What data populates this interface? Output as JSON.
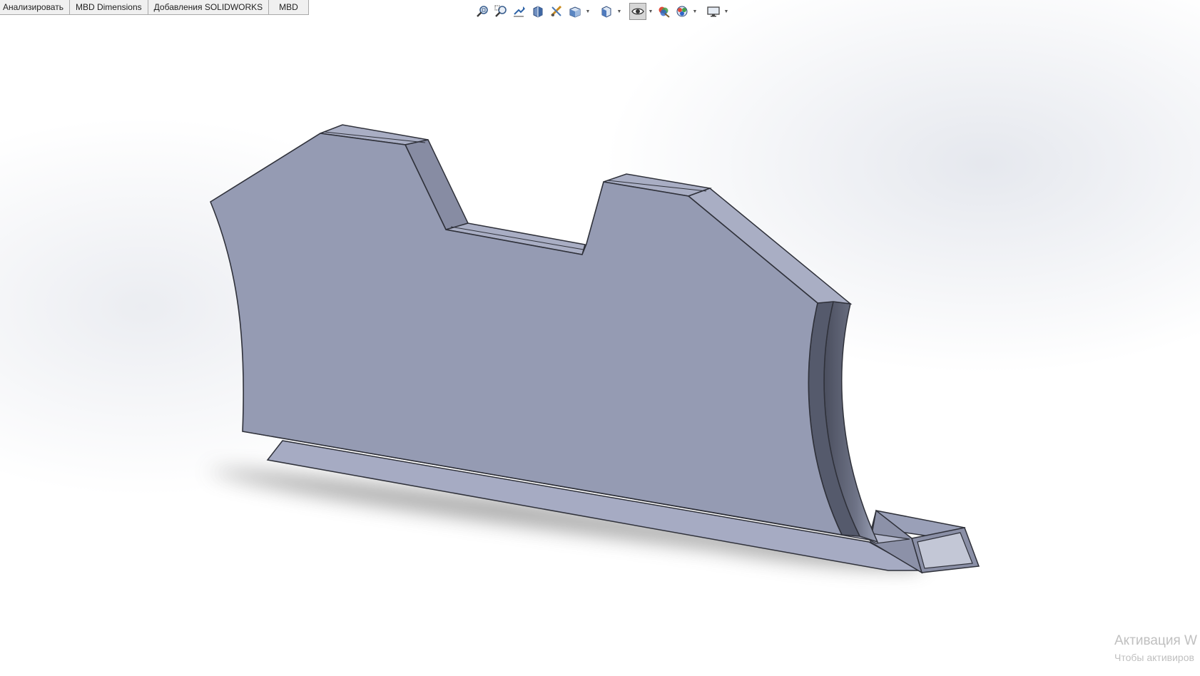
{
  "command_manager": {
    "tabs": [
      {
        "label": "Анализировать"
      },
      {
        "label": "MBD Dimensions"
      },
      {
        "label": "Добавления SOLIDWORKS"
      },
      {
        "label": "MBD"
      }
    ]
  },
  "heads_up_toolbar": {
    "buttons": [
      {
        "icon": "zoom-to-fit-icon"
      },
      {
        "icon": "zoom-to-area-icon"
      },
      {
        "icon": "previous-view-icon"
      },
      {
        "icon": "section-view-icon"
      },
      {
        "icon": "dynamic-annotation-views-icon"
      },
      {
        "icon": "view-orientation-icon",
        "has_dropdown": true
      },
      {
        "icon": "display-style-icon",
        "has_dropdown": true
      },
      {
        "icon": "hide-show-items-icon",
        "has_dropdown": true,
        "active": true
      },
      {
        "icon": "edit-appearance-icon"
      },
      {
        "icon": "apply-scene-icon",
        "has_dropdown": true
      },
      {
        "icon": "view-settings-icon",
        "has_dropdown": true
      }
    ]
  },
  "graphics_area": {
    "model_colors": {
      "face": "#959bb3",
      "edge": "#3a3c46",
      "top_face": "#a9aec4",
      "side_face": "#7d8398",
      "dark_face": "#5a5f72",
      "shadow": "#6f6f6f"
    }
  },
  "watermark": {
    "title": "Активация W",
    "subtitle": "Чтобы активиров"
  }
}
